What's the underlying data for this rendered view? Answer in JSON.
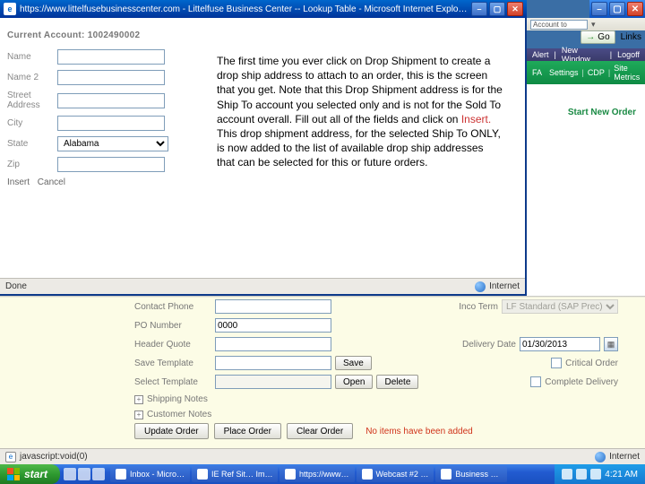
{
  "popup": {
    "title": "https://www.littelfusebusinesscenter.com - Littelfuse Business Center -- Lookup Table - Microsoft Internet Explo…",
    "status_done": "Done",
    "status_zone": "Internet",
    "account_label": "Current Account: 1002490002",
    "fields": {
      "name": "Name",
      "name2": "Name 2",
      "street": "Street Address",
      "city": "City",
      "state": "State",
      "zip": "Zip"
    },
    "state_value": "Alabama",
    "actions": {
      "insert": "Insert",
      "cancel": "Cancel"
    }
  },
  "explainer": {
    "text_before": "The first time you ever click on Drop Shipment to create a drop ship address to attach to an order, this is the screen that you get.  Note that this Drop Shipment address is for the Ship To account you selected only and is not for the Sold To account overall.  Fill out all of the fields and click on ",
    "insert_word": "Insert.",
    "text_after": "  This drop shipment address, for the selected Ship To ONLY, is now added to the list of available drop ship addresses that can be selected for this or future orders."
  },
  "main": {
    "addr_snippet": "Account to Prom",
    "go": "Go",
    "links": "Links",
    "header_items": [
      "Alert",
      "New Window",
      "Logoff"
    ],
    "nav": {
      "fa": "FA",
      "settings": "Settings",
      "cdp": "CDP",
      "site_metrics": "Site Metrics"
    },
    "start_order": "Start New Order"
  },
  "lower": {
    "contact_phone": "Contact Phone",
    "po_number_label": "PO Number",
    "po_number_value": "0000",
    "header_quote": "Header Quote",
    "save_template": "Save Template",
    "select_template": "Select Template",
    "save": "Save",
    "open": "Open",
    "delete": "Delete",
    "inco_term": "Inco Term",
    "inco_value": "LF Standard (SAP Prec)",
    "delivery_date": "Delivery Date",
    "delivery_date_value": "01/30/2013",
    "critical_order": "Critical Order",
    "complete_delivery": "Complete Delivery",
    "shipping_notes": "Shipping Notes",
    "customer_notes": "Customer Notes",
    "update_order": "Update Order",
    "place_order": "Place Order",
    "clear_order": "Clear Order",
    "no_items": "No items have been added"
  },
  "lower_status": {
    "text": "javascript:void(0)",
    "zone": "Internet"
  },
  "taskbar": {
    "start": "start",
    "tasks": [
      "Inbox - Micro…",
      "IE Ref Sit…  Im…",
      "https://www…",
      "Webcast #2 …",
      "Business …"
    ],
    "time": "4:21 AM"
  }
}
